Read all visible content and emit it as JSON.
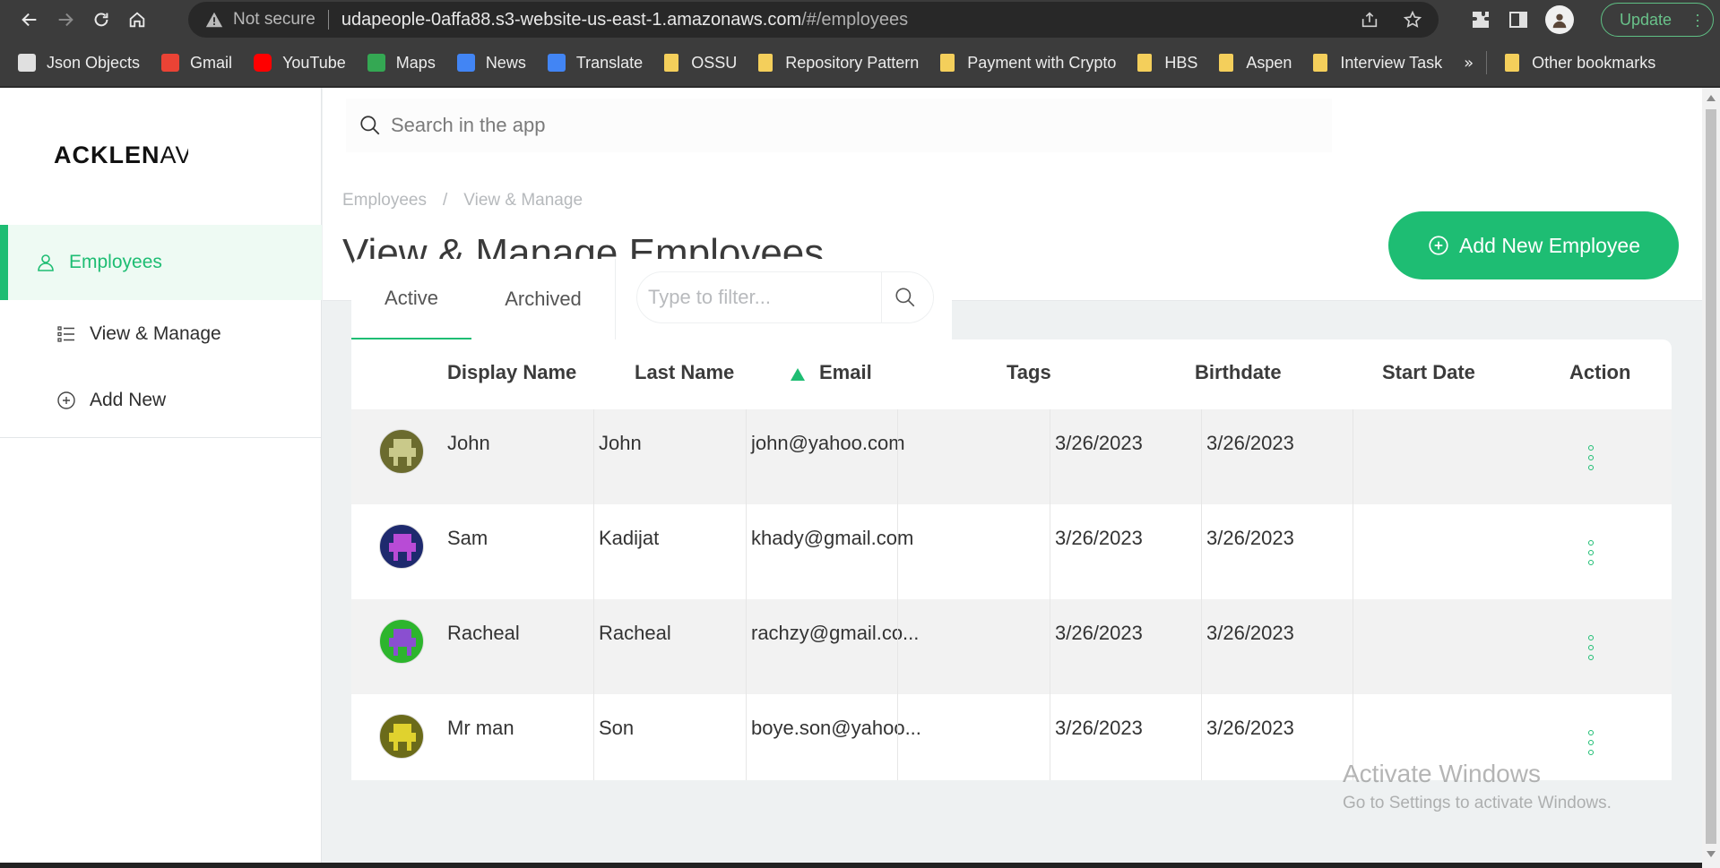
{
  "browser": {
    "security_label": "Not secure",
    "url_host": "udapeople-0affa88.s3-website-us-east-1.amazonaws.com",
    "url_path": "/#/employees",
    "update_label": "Update"
  },
  "bookmarks": {
    "items": [
      {
        "label": "Json Objects",
        "icon": "json-icon"
      },
      {
        "label": "Gmail",
        "icon": "gmail-icon"
      },
      {
        "label": "YouTube",
        "icon": "youtube-icon"
      },
      {
        "label": "Maps",
        "icon": "maps-icon"
      },
      {
        "label": "News",
        "icon": "news-icon"
      },
      {
        "label": "Translate",
        "icon": "translate-icon"
      },
      {
        "label": "OSSU",
        "icon": "folder-icon"
      },
      {
        "label": "Repository Pattern",
        "icon": "folder-icon"
      },
      {
        "label": "Payment with Crypto",
        "icon": "folder-icon"
      },
      {
        "label": "HBS",
        "icon": "folder-icon"
      },
      {
        "label": "Aspen",
        "icon": "folder-icon"
      },
      {
        "label": "Interview Task",
        "icon": "folder-icon"
      }
    ],
    "overflow": "»",
    "other": "Other bookmarks"
  },
  "app": {
    "logo": {
      "bold": "ACKLEN",
      "rest": "AVENUE"
    },
    "sidebar": {
      "items": [
        {
          "label": "Employees"
        },
        {
          "label": "View & Manage"
        },
        {
          "label": "Add New"
        }
      ]
    },
    "search": {
      "placeholder": "Search in the app"
    },
    "breadcrumb": {
      "root": "Employees",
      "separator": "/",
      "current": "View & Manage"
    },
    "title": "View & Manage Employees",
    "add_button": "Add New Employee",
    "tabs": [
      {
        "label": "Active"
      },
      {
        "label": "Archived"
      }
    ],
    "filter": {
      "placeholder": "Type to filter..."
    },
    "table": {
      "columns": [
        "Display Name",
        "Last Name",
        "Email",
        "Tags",
        "Birthdate",
        "Start Date",
        "Action"
      ],
      "sorted_column": "Email",
      "rows": [
        {
          "display_name": "John",
          "last_name": "John",
          "email": "john@yahoo.com",
          "tags": "",
          "birthdate": "3/26/2023",
          "start_date": "3/26/2023"
        },
        {
          "display_name": "Sam",
          "last_name": "Kadijat",
          "email": "khady@gmail.com",
          "tags": "",
          "birthdate": "3/26/2023",
          "start_date": "3/26/2023"
        },
        {
          "display_name": "Racheal",
          "last_name": "Racheal",
          "email": "rachzy@gmail.co...",
          "tags": "",
          "birthdate": "3/26/2023",
          "start_date": "3/26/2023"
        },
        {
          "display_name": "Mr man",
          "last_name": "Son",
          "email": "boye.son@yahoo...",
          "tags": "",
          "birthdate": "3/26/2023",
          "start_date": "3/26/2023"
        }
      ]
    }
  },
  "watermark": {
    "line1": "Activate Windows",
    "line2": "Go to Settings to activate Windows."
  },
  "colors": {
    "accent": "#1ebd73",
    "chrome": "#3c3c3c"
  }
}
